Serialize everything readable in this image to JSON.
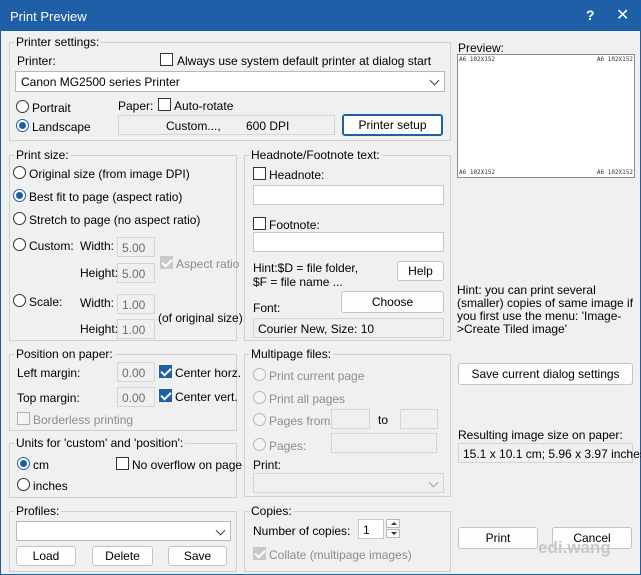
{
  "window": {
    "title": "Print Preview",
    "help_glyph": "?",
    "close_glyph": "✕"
  },
  "printer": {
    "legend": "Printer settings:",
    "printer_label": "Printer:",
    "always_default": "Always use system default printer at dialog start",
    "printer_name": "Canon MG2500 series Printer",
    "portrait": "Portrait",
    "landscape": "Landscape",
    "paper_label": "Paper:",
    "auto_rotate": "Auto-rotate",
    "paper_info": "Custom...,",
    "dpi": "600 DPI",
    "setup_button": "Printer setup"
  },
  "print_size": {
    "legend": "Print size:",
    "original": "Original size (from image DPI)",
    "best_fit": "Best fit to page (aspect ratio)",
    "stretch": "Stretch to page (no aspect ratio)",
    "custom": "Custom:",
    "width_label": "Width:",
    "height_label": "Height:",
    "custom_width": "5.00",
    "custom_height": "5.00",
    "aspect_ratio": "Aspect ratio",
    "scale": "Scale:",
    "scale_width": "1.00",
    "scale_height": "1.00",
    "of_original": "(of original size)"
  },
  "headnote": {
    "legend": "Headnote/Footnote text:",
    "headnote": "Headnote:",
    "footnote": "Footnote:",
    "hint_line1": "Hint:$D = file folder,",
    "hint_line2": "$F = file name ...",
    "help_button": "Help",
    "font_label": "Font:",
    "choose_button": "Choose",
    "font_value": "Courier New, Size: 10"
  },
  "position": {
    "legend": "Position on paper:",
    "left_margin": "Left margin:",
    "top_margin": "Top margin:",
    "left_value": "0.00",
    "top_value": "0.00",
    "center_horz": "Center horz.",
    "center_vert": "Center vert.",
    "borderless": "Borderless printing"
  },
  "multipage": {
    "legend": "Multipage files:",
    "current": "Print current page",
    "all": "Print all pages",
    "pages_from": "Pages from:",
    "to": "to",
    "pages": "Pages:",
    "print_label": "Print:"
  },
  "units": {
    "legend": "Units for 'custom' and 'position':",
    "cm": "cm",
    "inches": "inches",
    "no_overflow": "No overflow on page"
  },
  "profiles": {
    "legend": "Profiles:",
    "load": "Load",
    "delete": "Delete",
    "save": "Save"
  },
  "copies": {
    "legend": "Copies:",
    "number_label": "Number of copies:",
    "number_value": "1",
    "collate": "Collate (multipage images)"
  },
  "preview": {
    "label": "Preview:",
    "corner_text": "A6 102X152",
    "hint": "Hint: you can print several (smaller) copies of same image if you first use the menu: 'Image->Create Tiled image'",
    "save_settings": "Save current dialog settings",
    "result_label": "Resulting image size on paper:",
    "result_value": "15.1 x 10.1 cm; 5.96 x 3.97 inches"
  },
  "footer": {
    "print": "Print",
    "cancel": "Cancel",
    "watermark": "edi.wang"
  },
  "colors": {
    "accent": "#1f5fa8",
    "background": "#f0f0f0"
  }
}
